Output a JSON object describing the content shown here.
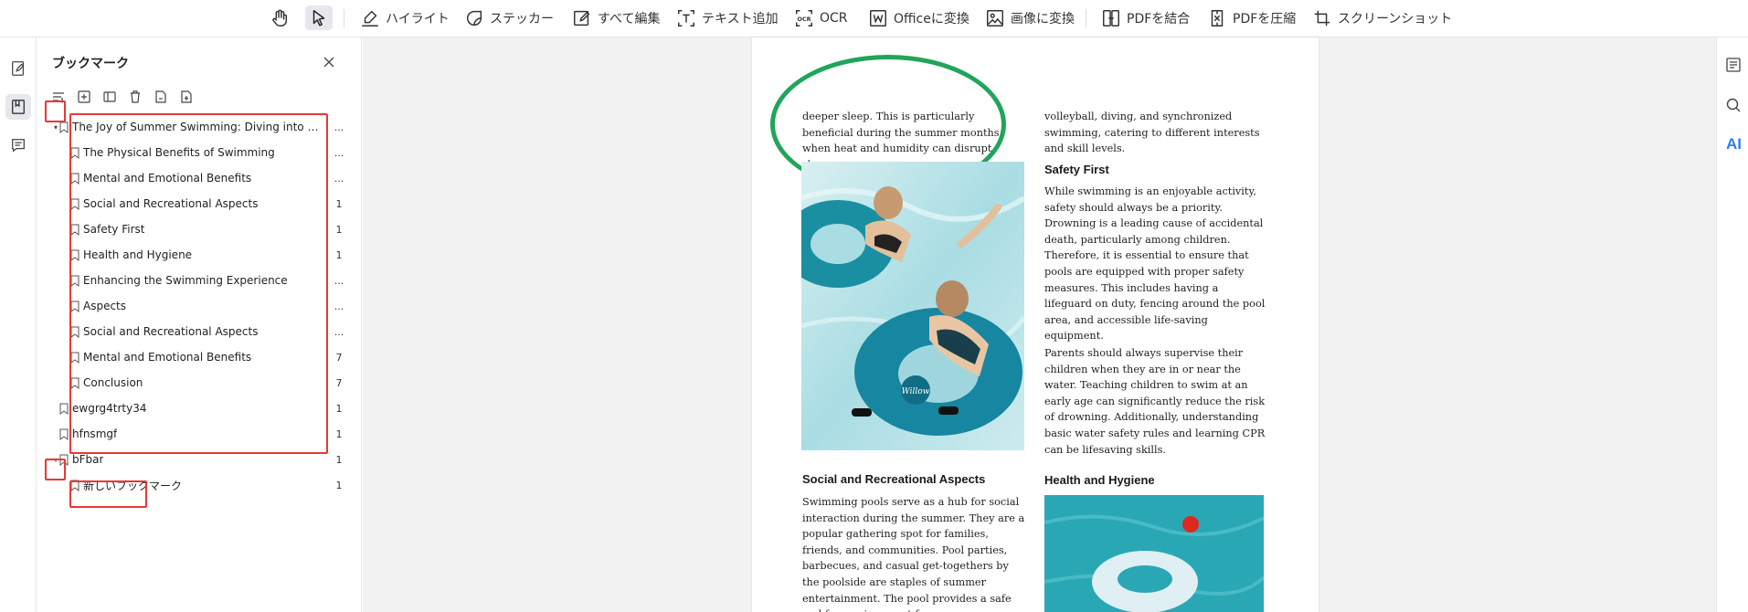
{
  "toolbar": {
    "hand_tool_icon": "hand-icon",
    "select_tool_icon": "cursor-arrow-icon",
    "items": [
      {
        "label": "ハイライト",
        "icon": "highlighter-icon"
      },
      {
        "label": "ステッカー",
        "icon": "sticker-icon"
      },
      {
        "label": "すべて編集",
        "icon": "edit-icon"
      },
      {
        "label": "テキスト追加",
        "icon": "add-text-icon"
      },
      {
        "label": "OCR",
        "icon": "ocr-icon"
      },
      {
        "label": "Officeに変換",
        "icon": "office-convert-icon"
      },
      {
        "label": "画像に変換",
        "icon": "image-convert-icon"
      },
      {
        "label": "PDFを結合",
        "icon": "merge-pdf-icon"
      },
      {
        "label": "PDFを圧縮",
        "icon": "compress-pdf-icon"
      },
      {
        "label": "スクリーンショット",
        "icon": "screenshot-icon"
      }
    ]
  },
  "left_rail": {
    "icons": [
      "edit-page-icon",
      "bookmark-icon",
      "comment-icon"
    ],
    "active": "bookmark-icon"
  },
  "bookmark_panel": {
    "title": "ブックマーク",
    "tool_icons": [
      "sort-icon",
      "add-bookmark-icon",
      "expand-collapse-icon",
      "delete-icon",
      "export-icon",
      "import-icon"
    ],
    "items": [
      {
        "label": "The Joy of Summer Swimming: Diving into the ...",
        "page": "...",
        "level": 0,
        "expanded": true
      },
      {
        "label": "The Physical Benefits of Swimming",
        "page": "...",
        "level": 1
      },
      {
        "label": "Mental and Emotional Benefits",
        "page": "...",
        "level": 1
      },
      {
        "label": "Social and Recreational Aspects",
        "page": "1",
        "level": 1
      },
      {
        "label": "Safety First",
        "page": "1",
        "level": 1
      },
      {
        "label": "Health and Hygiene",
        "page": "1",
        "level": 1
      },
      {
        "label": "Enhancing the Swimming Experience",
        "page": "...",
        "level": 1
      },
      {
        "label": "Aspects",
        "page": "...",
        "level": 1
      },
      {
        "label": "Social and Recreational Aspects",
        "page": "...",
        "level": 1
      },
      {
        "label": "Mental and Emotional Benefits",
        "page": "7",
        "level": 1
      },
      {
        "label": "Conclusion",
        "page": "7",
        "level": 1
      },
      {
        "label": "ewgrg4trty34",
        "page": "1",
        "level": 0
      },
      {
        "label": "hfnsmgf",
        "page": "1",
        "level": 0
      },
      {
        "label": "bFbar",
        "page": "1",
        "level": 0,
        "expanded": true
      },
      {
        "label": "新しいブックマーク",
        "page": "1",
        "level": 1
      }
    ]
  },
  "document": {
    "left_intro": "deeper sleep. This is particularly beneficial during the summer months when heat and humidity can disrupt sleep.",
    "right_intro": "volleyball, diving, and synchronized swimming, catering to different interests and skill levels.",
    "safety_heading": "Safety First",
    "safety_p1": "While swimming is an enjoyable activity, safety should always be a priority. Drowning is a leading cause of accidental death, particularly among children. Therefore, it is essential to ensure that pools are equipped with proper safety measures. This includes having a lifeguard on duty, fencing around the pool area, and accessible life-saving equipment.",
    "safety_p2": "Parents should always supervise their children when they are in or near the water. Teaching children to swim at an early age can significantly reduce the risk of drowning. Additionally, understanding basic water safety rules and learning CPR can be lifesaving skills.",
    "social_heading": "Social and Recreational Aspects",
    "social_p": "Swimming pools serve as a hub for social interaction during the summer. They are a popular gathering spot for families, friends, and communities. Pool parties, barbecues, and casual get-togethers by the poolside are staples of summer entertainment. The pool provides a safe and fun environment for",
    "health_heading": "Health and Hygiene",
    "photo_float_text": "Willow"
  },
  "right_rail": {
    "icons": [
      "properties-icon",
      "search-icon"
    ],
    "ai_label": "AI"
  },
  "colors": {
    "annotation_red": "#e53935",
    "annotation_green": "#20a55a",
    "ai_blue": "#2f7df6"
  }
}
